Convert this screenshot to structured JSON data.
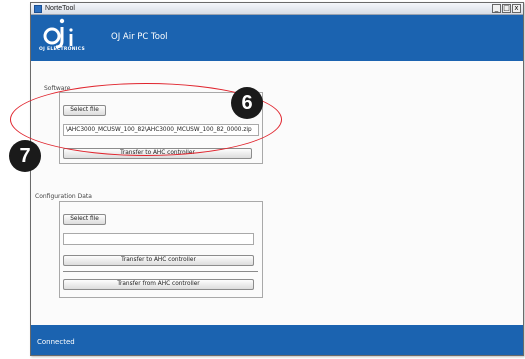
{
  "window": {
    "title": "NorteTool",
    "controls": {
      "minimize": "_",
      "maximize": "□",
      "close": "x"
    }
  },
  "header": {
    "logo_text": "OJ ELECTRONICS",
    "app_name": "OJ Air PC Tool"
  },
  "software": {
    "label": "Software",
    "select_file": "Select file",
    "file_path": "\\AHC3000_MCUSW_100_82\\AHC3000_MCUSW_100_82_0000.zip",
    "transfer_to": "Transfer to AHC controller"
  },
  "configuration": {
    "label": "Configuration Data",
    "select_file": "Select file",
    "file_path": "",
    "transfer_to": "Transfer to AHC controller",
    "transfer_from": "Transfer from AHC controller"
  },
  "status": {
    "text": "Connected"
  },
  "callouts": {
    "badge_6": "6",
    "badge_7": "7"
  },
  "colors": {
    "brand_blue": "#1b63b0",
    "callout_red": "#e0242d"
  }
}
